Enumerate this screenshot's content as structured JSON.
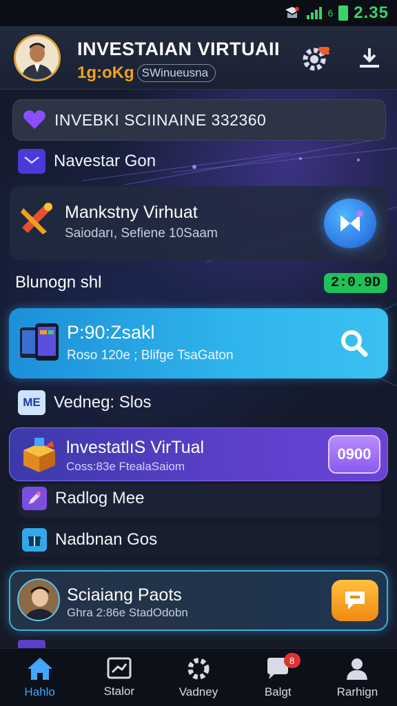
{
  "status_bar": {
    "network": "6",
    "time": "2.35"
  },
  "header": {
    "title": "INVESTAIAN VIRTUAII",
    "accent": "1g:oKg",
    "pill": "SWinueusna"
  },
  "search": {
    "label": "INVEBKI SCIINAINE 332360"
  },
  "rows": {
    "row1_label": "Navestar Gon",
    "row2_label": "Vedneg: Slos",
    "row2_icon_text": "ME",
    "row3_label": "Radlog Mee",
    "row4_label": "Nadbnan Gos"
  },
  "card_virtual": {
    "title": "Mankstny Virhuat",
    "sub": "Saiodarı, Sefiene 10Saam"
  },
  "section": {
    "label": "Blunogn shl",
    "badge": "2:0.9D"
  },
  "card_blue": {
    "title": "P:90:Zsakl",
    "sub": "Roso 120e ; Blifge TsaGaton"
  },
  "card_purple": {
    "title": "lnvestatlıS VirTual",
    "sub": "Coss:83e FtealaSaiom",
    "badge": "0900"
  },
  "card_social": {
    "title": "Sciaiang Paots",
    "sub": "Ghra 2:86e StadOdobn"
  },
  "nav": {
    "items": [
      {
        "label": "Hahlo",
        "icon": "home-icon"
      },
      {
        "label": "Stalor",
        "icon": "chart-icon"
      },
      {
        "label": "Vadney",
        "icon": "gear-icon"
      },
      {
        "label": "Balgt",
        "icon": "chat-icon",
        "badge": "8"
      },
      {
        "label": "Rarhign",
        "icon": "profile-icon"
      }
    ]
  },
  "colors": {
    "accent_blue": "#3fa7ff",
    "accent_green": "#22c05a",
    "accent_purple": "#7a4fe0",
    "accent_orange": "#f0a020"
  }
}
